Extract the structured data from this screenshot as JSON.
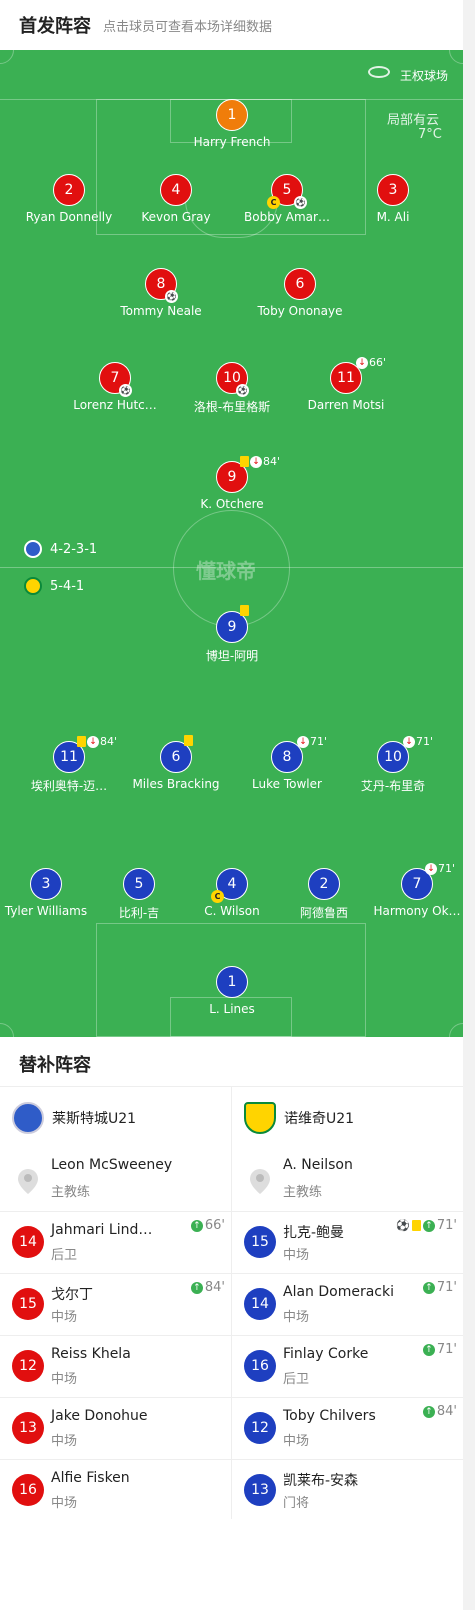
{
  "header": {
    "title": "首发阵容",
    "subtitle": "点击球员可查看本场详细数据"
  },
  "venue": {
    "name": "王权球场",
    "weather": "局部有云",
    "temperature": "7°C"
  },
  "watermark": "懂球帝",
  "formations": {
    "home": "4-2-3-1",
    "away": "5-4-1"
  },
  "home_players": [
    {
      "num": "1",
      "name": "Harry French",
      "color": "orange"
    },
    {
      "num": "2",
      "name": "Ryan Donnelly"
    },
    {
      "num": "4",
      "name": "Kevon Gray"
    },
    {
      "num": "5",
      "name": "Bobby Amar…",
      "captain": "C",
      "icons": [
        "ball"
      ]
    },
    {
      "num": "3",
      "name": "M. Ali"
    },
    {
      "num": "8",
      "name": "Tommy Neale",
      "icons": [
        "ball"
      ]
    },
    {
      "num": "6",
      "name": "Toby Ononaye"
    },
    {
      "num": "7",
      "name": "Lorenz Hutc…",
      "icons": [
        "ball"
      ]
    },
    {
      "num": "10",
      "name": "洛根-布里格斯",
      "icons": [
        "ball"
      ]
    },
    {
      "num": "11",
      "name": "Darren Motsi",
      "event": "66'"
    },
    {
      "num": "9",
      "name": "K. Otchere",
      "event": "84'"
    }
  ],
  "away_players": [
    {
      "num": "9",
      "name": "博坦-阿明"
    },
    {
      "num": "11",
      "name": "埃利奥特-迈…",
      "event": "84'"
    },
    {
      "num": "6",
      "name": "Miles Bracking"
    },
    {
      "num": "8",
      "name": "Luke Towler",
      "event": "71'"
    },
    {
      "num": "10",
      "name": "艾丹-布里奇",
      "event": "71'"
    },
    {
      "num": "3",
      "name": "Tyler Williams"
    },
    {
      "num": "5",
      "name": "比利-吉"
    },
    {
      "num": "4",
      "name": "C. Wilson",
      "captain": "C"
    },
    {
      "num": "2",
      "name": "阿德鲁西"
    },
    {
      "num": "7",
      "name": "Harmony Ok…",
      "event": "71'"
    },
    {
      "num": "1",
      "name": "L. Lines"
    }
  ],
  "subs": {
    "title": "替补阵容",
    "home": {
      "team": "莱斯特城U21",
      "coach": {
        "name": "Leon McSweeney",
        "role": "主教练"
      },
      "players": [
        {
          "num": "14",
          "name": "Jahmari Lind…",
          "pos": "后卫",
          "event": "66'"
        },
        {
          "num": "15",
          "name": "戈尔丁",
          "pos": "中场",
          "event": "84'"
        },
        {
          "num": "12",
          "name": "Reiss Khela",
          "pos": "中场"
        },
        {
          "num": "13",
          "name": "Jake Donohue",
          "pos": "中场"
        },
        {
          "num": "16",
          "name": "Alfie Fisken",
          "pos": "中场"
        }
      ]
    },
    "away": {
      "team": "诺维奇U21",
      "coach": {
        "name": "A. Neilson",
        "role": "主教练"
      },
      "players": [
        {
          "num": "15",
          "name": "扎克-鲍曼",
          "pos": "中场",
          "event": "71'"
        },
        {
          "num": "14",
          "name": "Alan Domeracki",
          "pos": "中场",
          "event": "71'"
        },
        {
          "num": "16",
          "name": "Finlay Corke",
          "pos": "后卫",
          "event": "71'"
        },
        {
          "num": "12",
          "name": "Toby Chilvers",
          "pos": "中场",
          "event": "84'"
        },
        {
          "num": "13",
          "name": "凯莱布-安森",
          "pos": "门将"
        }
      ]
    }
  },
  "colors": {
    "pitch": "#3bb053",
    "home": "#e10f0f",
    "away": "#1e3fc0",
    "keeper": "#f07d0a"
  }
}
